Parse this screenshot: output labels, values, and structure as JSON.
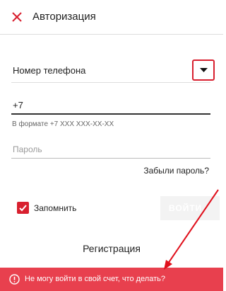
{
  "header": {
    "title": "Авторизация",
    "close_icon": "close-icon"
  },
  "login_type": {
    "selected": "Номер телефона",
    "dropdown_icon": "caret-down-icon"
  },
  "phone": {
    "value": "+7",
    "hint": "В формате +7 XXX XXX-XX-XX"
  },
  "password": {
    "placeholder": "Пароль"
  },
  "forgot_password": "Забыли пароль?",
  "remember": {
    "label": "Запомнить",
    "checked": true
  },
  "login_button": "ВОЙТИ",
  "register_link": "Регистрация",
  "help_banner": {
    "text": "Не могу войти в свой счет, что делать?",
    "icon": "alert-circle-icon"
  },
  "colors": {
    "accent": "#d8202f",
    "banner": "#e8404e",
    "annotation": "#e0101c"
  }
}
